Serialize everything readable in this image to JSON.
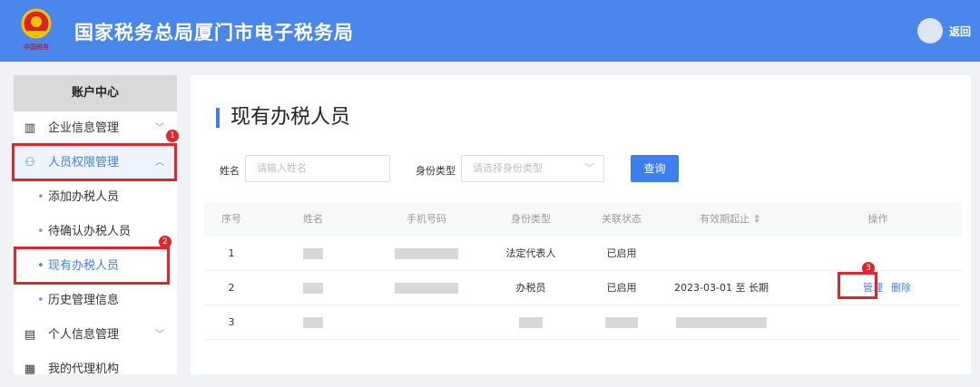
{
  "header": {
    "title": "国家税务总局厦门市电子税务局",
    "back": "返回",
    "colors": {
      "bar": "#4a87ec"
    }
  },
  "sidebar": {
    "title": "账户中心",
    "items": [
      {
        "label": "企业信息管理",
        "icon": "building-icon"
      },
      {
        "label": "人员权限管理",
        "icon": "user-lock-icon"
      },
      {
        "label": "添加办税人员"
      },
      {
        "label": "待确认办税人员"
      },
      {
        "label": "现有办税人员"
      },
      {
        "label": "历史管理信息"
      },
      {
        "label": "个人信息管理",
        "icon": "id-card-icon"
      },
      {
        "label": "我的代理机构",
        "icon": "agency-icon"
      }
    ]
  },
  "badges": [
    "1",
    "2",
    "3"
  ],
  "main": {
    "title": "现有办税人员",
    "filters": {
      "name_label": "姓名",
      "name_placeholder": "请输入姓名",
      "type_label": "身份类型",
      "type_placeholder": "请选择身份类型",
      "query": "查询"
    },
    "columns": [
      "序号",
      "姓名",
      "手机号码",
      "身份类型",
      "关联状态",
      "有效期起止 ⇕",
      "操作"
    ],
    "rows": [
      {
        "no": "1",
        "type": "法定代表人",
        "status": "已启用",
        "period": ""
      },
      {
        "no": "2",
        "type": "办税员",
        "status": "已启用",
        "period": "2023-03-01 至 长期",
        "manage": "管理",
        "delete": "删除"
      },
      {
        "no": "3",
        "type": "",
        "status": "",
        "period": ""
      }
    ]
  }
}
